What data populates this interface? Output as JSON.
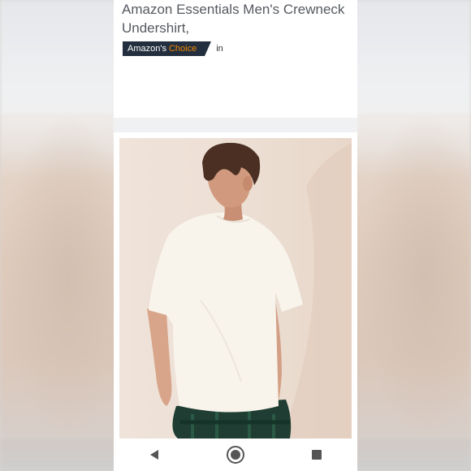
{
  "product": {
    "title_line1": "Amazon Essentials Men's Crewneck",
    "title_line2": "Undershirt,"
  },
  "badge": {
    "prefix": "Amazon's",
    "highlight": "Choice",
    "suffix": "in"
  },
  "image": {
    "alt": "product-photo-man-white-tshirt"
  },
  "navbar": {
    "back_icon": "back-triangle-icon",
    "home_icon": "home-circle-icon",
    "recents_icon": "recents-square-icon"
  },
  "colors": {
    "badge_bg": "#232f3e",
    "badge_accent": "#f08804",
    "title_text": "#555a60"
  }
}
